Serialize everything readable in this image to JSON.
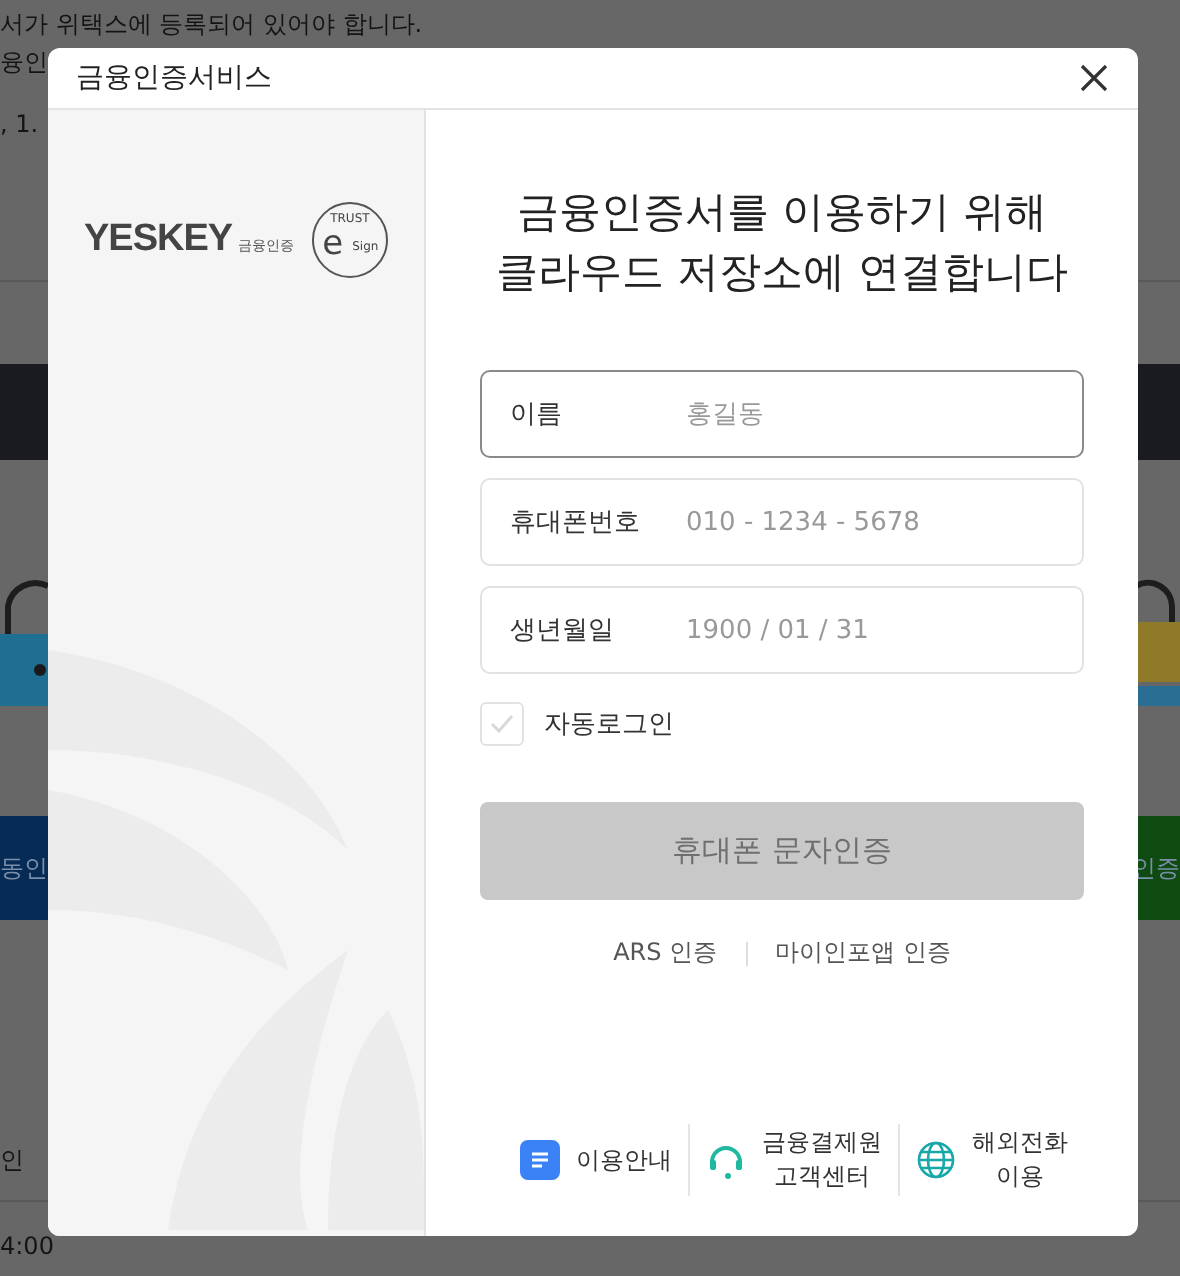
{
  "background_page": {
    "notice": "서가 위택스에 등록되어 있어야 합니다.",
    "line_2": "융인",
    "line_3": ",  1.",
    "left_button": "동인",
    "right_button": "인증",
    "row_label": "인",
    "time": "4:00"
  },
  "dialog": {
    "title": "금융인증서비스",
    "logo": {
      "wordmark": "YESKEY",
      "sub": "금융인증",
      "badge_top": "TRUST",
      "badge_letter": "e",
      "badge_bottom": "Sign"
    },
    "heading": "금융인증서를 이용하기 위해\n클라우드 저장소에 연결합니다",
    "fields": [
      {
        "label": "이름",
        "placeholder": "홍길동",
        "focused": true
      },
      {
        "label": "휴대폰번호",
        "placeholder": "010 - 1234 - 5678",
        "focused": false
      },
      {
        "label": "생년월일",
        "placeholder": "1900 / 01 / 31",
        "focused": false
      }
    ],
    "auto_login": {
      "label": "자동로그인",
      "checked": false
    },
    "submit": {
      "label": "휴대폰 문자인증",
      "disabled": true
    },
    "alt_methods": [
      "ARS 인증",
      "마이인포앱 인증"
    ],
    "footer": [
      {
        "kind": "guide",
        "label": "이용안내"
      },
      {
        "kind": "support",
        "label": "금융결제원\n고객센터"
      },
      {
        "kind": "global",
        "label": "해외전화\n이용"
      }
    ]
  }
}
